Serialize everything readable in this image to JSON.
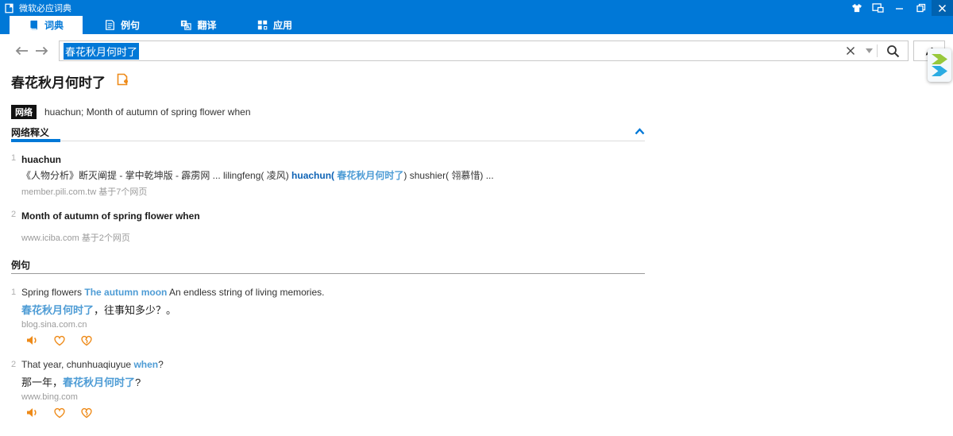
{
  "colors": {
    "accent": "#0078d7",
    "selection_bg": "#0078d7",
    "link_blue": "#0e63b5",
    "keyword_blue": "#4e9cd5",
    "orange": "#ee8a18",
    "tag_bg": "#111111"
  },
  "window": {
    "title": "微软必应词典",
    "control_icons": [
      "skin-shirt-icon",
      "mini-window-icon",
      "minimize-icon",
      "restore-icon",
      "close-icon"
    ]
  },
  "tabs": [
    {
      "label": "词典",
      "icon": "dictionary-book-icon",
      "active": true
    },
    {
      "label": "例句",
      "icon": "example-sentences-icon",
      "active": false
    },
    {
      "label": "翻译",
      "icon": "translate-icon",
      "active": false
    },
    {
      "label": "应用",
      "icon": "apps-grid-icon",
      "active": false
    }
  ],
  "toolbar": {
    "back_icon": "back-arrow-icon",
    "forward_icon": "forward-arrow-icon",
    "query": "春花秋月何时了",
    "clear_icon": "clear-x-icon",
    "dropdown_icon": "chevron-down-icon",
    "search_icon": "magnifier-icon",
    "handwriting_icon": "pen-icon",
    "widget_icon": "snap-widget-icon"
  },
  "entry": {
    "headword": "春花秋月何时了",
    "add_icon": "add-to-notebook-icon",
    "web_tag": "网络",
    "web_summary": "huachun; Month of autumn of spring flower when"
  },
  "web_definitions": {
    "title": "网络释义",
    "collapse_icon": "chevron-up-icon",
    "items": [
      {
        "index": "1",
        "term": "huachun",
        "desc_before": "《人物分析》断灭阐提 - 掌中乾坤版 - 霹雳网 ... lilingfeng( 凌风) ",
        "desc_link": "huachun(",
        "desc_keyword": " 春花秋月何时了",
        "desc_after": ") shushier( 翎慕惜) ...",
        "source": "member.pili.com.tw",
        "pages": "基于7个网页"
      },
      {
        "index": "2",
        "term": "Month of autumn of spring flower when",
        "source": "www.iciba.com",
        "pages": "基于2个网页"
      }
    ]
  },
  "examples": {
    "title": "例句",
    "action_icons": [
      "speaker-icon",
      "like-heart-icon",
      "dislike-broken-heart-icon"
    ],
    "items": [
      {
        "index": "1",
        "en_before": "Spring flowers ",
        "en_keyword": "The autumn moon",
        "en_after": " An endless string of living memories.",
        "zh_before": "",
        "zh_keyword": "春花秋月何时了",
        "zh_after": "，往事知多少？。",
        "source": "blog.sina.com.cn"
      },
      {
        "index": "2",
        "en_before": "That year, chunhuaqiuyue ",
        "en_keyword": "when",
        "en_after": "?",
        "zh_before": "那一年，",
        "zh_keyword": "春花秋月何时了",
        "zh_after": "?",
        "source": "www.bing.com"
      }
    ]
  }
}
